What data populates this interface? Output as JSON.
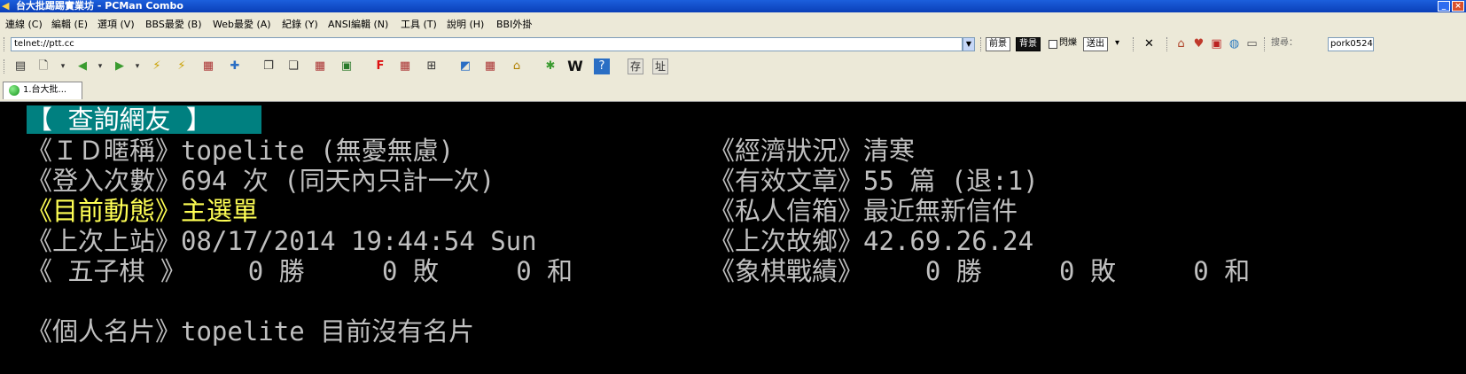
{
  "window": {
    "title": "台大批踢踢實業坊 - PCMan Combo",
    "minimize": "_",
    "close": "×"
  },
  "menu": [
    "連線 (C)",
    "編輯 (E)",
    "選項 (V)",
    "BBS最愛 (B)",
    "Web最愛 (A)",
    "紀錄 (Y)",
    "ANSI編輯 (N)",
    "工具 (T)",
    "說明 (H)",
    "BBI外掛"
  ],
  "address": {
    "value": "telnet://ptt.cc"
  },
  "toolbar": {
    "foreground": "前景",
    "background": "背景",
    "blink": "閃爍",
    "send": "送出",
    "search_label": "搜尋：",
    "search_value": "pork0524",
    "store": "存",
    "site": "址",
    "w": "W",
    "f": "F"
  },
  "tab": {
    "label": "1.台大批..."
  },
  "terminal": {
    "header": "【 查詢網友 】",
    "left": [
      "《ＩＤ暱稱》topelite (無憂無慮)",
      "《登入次數》694 次 (同天內只計一次)",
      "《目前動態》主選單",
      "《上次上站》08/17/2014 19:44:54 Sun",
      "《 五子棋 》    0 勝     0 敗     0 和",
      "",
      "《個人名片》topelite 目前沒有名片"
    ],
    "right": [
      "《經濟狀況》清寒",
      "《有效文章》55 篇 (退:1)",
      "《私人信箱》最近無新信件",
      "《上次故鄉》42.69.26.24",
      "《象棋戰績》    0 勝     0 敗     0 和"
    ]
  },
  "colors": {
    "terminal_bg": "#000000",
    "terminal_text": "#c0c0c0",
    "highlight_text": "#ffff55",
    "header_bg": "#008080"
  }
}
